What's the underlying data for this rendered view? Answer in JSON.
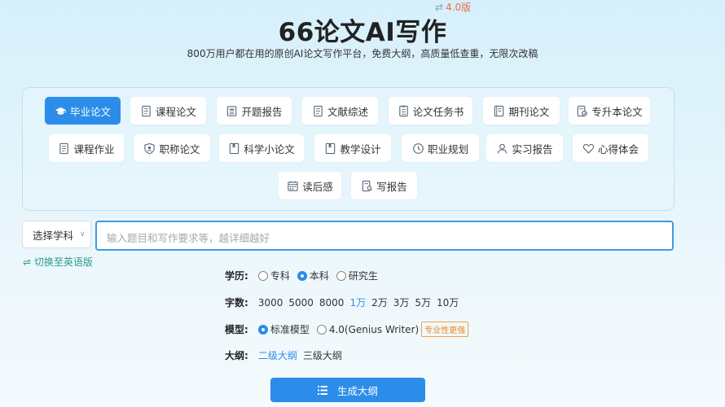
{
  "header": {
    "title": "66论文AI写作",
    "version": "4.0版",
    "subtitle": "800万用户都在用的原创AI论文写作平台，免费大纲，高质量低查重，无限次改稿"
  },
  "categories": [
    {
      "label": "毕业论文",
      "icon": "graduation-cap-icon",
      "active": true
    },
    {
      "label": "课程论文",
      "icon": "document-icon"
    },
    {
      "label": "开题报告",
      "icon": "report-icon"
    },
    {
      "label": "文献综述",
      "icon": "document-icon"
    },
    {
      "label": "论文任务书",
      "icon": "task-list-icon"
    },
    {
      "label": "期刊论文",
      "icon": "journal-icon"
    },
    {
      "label": "专升本论文",
      "icon": "document-edit-icon"
    },
    {
      "label": "课程作业",
      "icon": "document-icon"
    },
    {
      "label": "职称论文",
      "icon": "shield-icon"
    },
    {
      "label": "科学小论文",
      "icon": "book-icon"
    },
    {
      "label": "教学设计",
      "icon": "book-icon"
    },
    {
      "label": "职业规划",
      "icon": "clock-icon"
    },
    {
      "label": "实习报告",
      "icon": "user-icon"
    },
    {
      "label": "心得体会",
      "icon": "heart-icon"
    },
    {
      "label": "读后感",
      "icon": "calendar-icon"
    },
    {
      "label": "写报告",
      "icon": "document-search-icon"
    }
  ],
  "form": {
    "subject_label": "选择学科",
    "topic_placeholder": "输入题目和写作要求等，越详细越好",
    "switch_language": "⇌ 切换至英语版",
    "education": {
      "label": "学历:",
      "options": [
        "专科",
        "本科",
        "研究生"
      ],
      "selected": "本科"
    },
    "word_count": {
      "label": "字数:",
      "options": [
        "3000",
        "5000",
        "8000",
        "1万",
        "2万",
        "3万",
        "5万",
        "10万"
      ],
      "selected": "1万"
    },
    "model": {
      "label": "模型:",
      "options": [
        "标准模型",
        "4.0(Genius Writer)"
      ],
      "selected": "标准模型",
      "badge": "专业性更强"
    },
    "outline": {
      "label": "大纲:",
      "options": [
        "二级大纲",
        "三级大纲"
      ],
      "selected": "二级大纲"
    },
    "generate_button": "生成大纲"
  },
  "colors": {
    "accent": "#2b8de9",
    "version": "#f06a4a",
    "badge": "#f08a1e",
    "switch_link": "#2b9a8a"
  }
}
